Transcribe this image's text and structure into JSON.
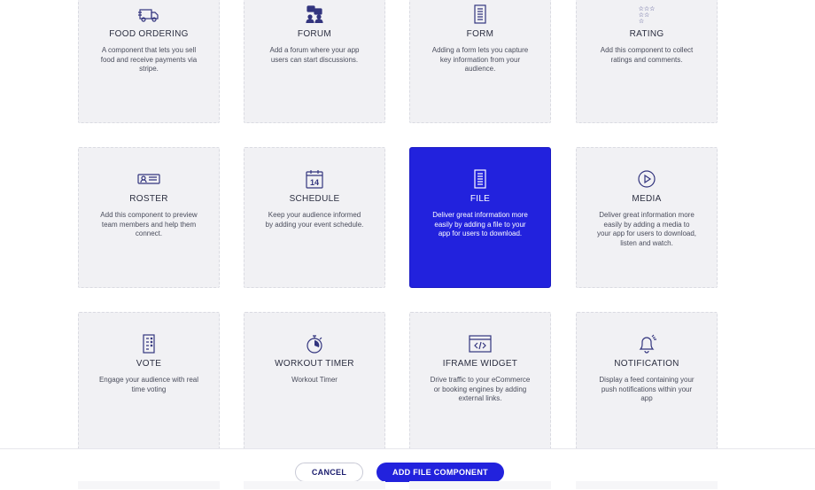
{
  "components": [
    {
      "title": "FOOD ORDERING",
      "desc": "A component that lets you sell food and receive payments via stripe.",
      "icon": "truck-icon"
    },
    {
      "title": "FORUM",
      "desc": "Add a forum where your app users can start discussions.",
      "icon": "forum-icon"
    },
    {
      "title": "FORM",
      "desc": "Adding a form lets you capture key information from your audience.",
      "icon": "form-icon"
    },
    {
      "title": "RATING",
      "desc": "Add this component to collect ratings and comments.",
      "icon": "stars-icon"
    },
    {
      "title": "ROSTER",
      "desc": "Add this component to preview team members and help them connect.",
      "icon": "id-card-icon"
    },
    {
      "title": "SCHEDULE",
      "desc": "Keep your audience informed by adding your event schedule.",
      "icon": "calendar-icon",
      "icon_text": "14"
    },
    {
      "title": "FILE",
      "desc": "Deliver great information more easily by adding a file to your app for users to download.",
      "icon": "file-icon",
      "selected": true
    },
    {
      "title": "MEDIA",
      "desc": "Deliver great information more easily by adding a media to your app for users to download, listen and watch.",
      "icon": "play-icon"
    },
    {
      "title": "VOTE",
      "desc": "Engage your audience with real time voting",
      "icon": "vote-list-icon"
    },
    {
      "title": "WORKOUT TIMER",
      "desc": "Workout Timer",
      "icon": "stopwatch-icon"
    },
    {
      "title": "IFRAME WIDGET",
      "desc": "Drive traffic to your eCommerce or booking engines by adding external links.",
      "icon": "code-window-icon"
    },
    {
      "title": "NOTIFICATION",
      "desc": "Display a feed containing your push notifications within your app",
      "icon": "bell-icon"
    }
  ],
  "footer": {
    "cancel_label": "CANCEL",
    "add_label": "ADD FILE COMPONENT"
  },
  "colors": {
    "accent": "#2222dd",
    "card_bg": "#f1f1f4",
    "icon_stroke": "#33357e"
  }
}
